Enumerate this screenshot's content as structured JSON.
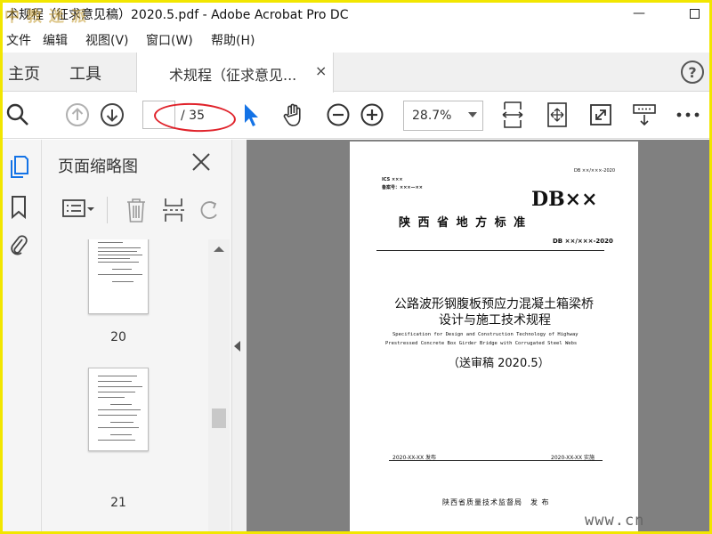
{
  "window": {
    "title": "术规程（征求意见稿）2020.5.pdf - Adobe Acrobat Pro DC",
    "watermark": "中 教 迷 派",
    "minimize_symbol": "—"
  },
  "menu": [
    "文件",
    "编辑",
    "视图(V)",
    "窗口(W)",
    "帮助(H)"
  ],
  "tabs": {
    "home": "主页",
    "tools": "工具",
    "document": "术规程（征求意见...",
    "close": "×",
    "help": "?"
  },
  "toolbar": {
    "page_current": "",
    "page_total": "/ 35",
    "zoom": "28.7%"
  },
  "thumbnail_panel": {
    "title": "页面缩略图",
    "pages": [
      "20",
      "21"
    ]
  },
  "document_page": {
    "ics": "ICS ×××",
    "record_no": "备案号：×××—××",
    "std_no_top": "DB ××/×××-2020",
    "db_title": "DB××",
    "province_std": "陕 西 省 地 方 标 准",
    "std_no": "DB ××/×××-2020",
    "title_cn_1": "公路波形钢腹板预应力混凝土箱梁桥",
    "title_cn_2": "设计与施工技术规程",
    "title_en_1": "Specification for Design and Construction Technology of Highway",
    "title_en_2": "Prestressed Concrete Box Girder Bridge with Corrugated Steel Webs",
    "draft": "（送审稿 2020.5）",
    "publish_date": "2020-XX-XX 发布",
    "implement_date": "2020-XX-XX 实施",
    "issuer": "陕西省质量技术监督局　发 布"
  },
  "site_watermark": "www.cn"
}
